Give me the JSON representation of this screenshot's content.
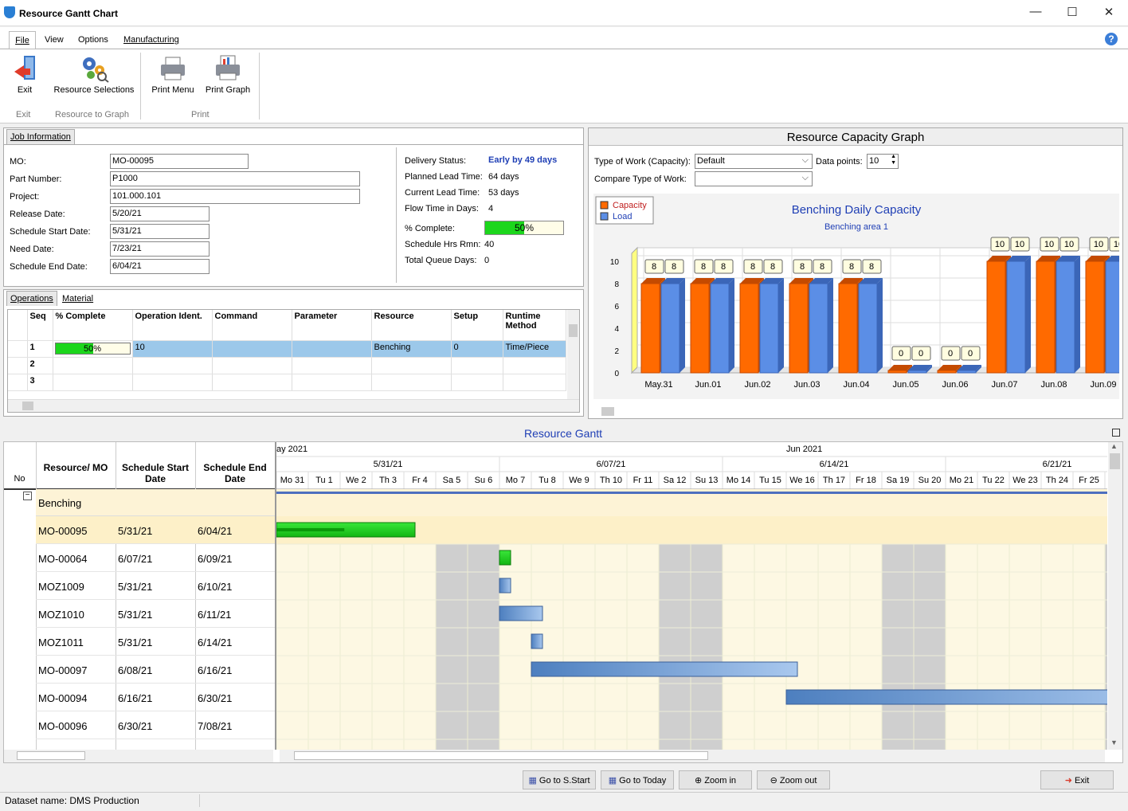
{
  "window": {
    "title": "Resource Gantt Chart",
    "minimize": "—",
    "maximize": "☐",
    "close": "✕"
  },
  "menu": {
    "file": "File",
    "view": "View",
    "options": "Options",
    "manufacturing": "Manufacturing",
    "help": "?"
  },
  "ribbon": {
    "exit": "Exit",
    "resource_selections": "Resource Selections",
    "print_menu": "Print Menu",
    "print_graph": "Print Graph",
    "group_exit": "Exit",
    "group_resource": "Resource to Graph",
    "group_print": "Print"
  },
  "job": {
    "tab": "Job Information",
    "mo_label": "MO:",
    "mo": "MO-00095",
    "part_label": "Part Number:",
    "part": "P1000",
    "project_label": "Project:",
    "project": "101.000.101",
    "release_label": "Release Date:",
    "release": "5/20/21",
    "start_label": "Schedule Start Date:",
    "start": "5/31/21",
    "need_label": "Need Date:",
    "need": "7/23/21",
    "end_label": "Schedule End Date:",
    "end": "6/04/21",
    "delivery_label": "Delivery Status:",
    "delivery": "Early by 49 days",
    "planned_label": "Planned Lead Time:",
    "planned": "64 days",
    "current_label": "Current Lead Time:",
    "current": "53 days",
    "flow_label": "Flow Time in Days:",
    "flow": "4",
    "pct_label": "% Complete:",
    "pct": "50%",
    "pct_value": 0.5,
    "hrs_label": "Schedule Hrs Rmn:",
    "hrs": "40",
    "queue_label": "Total Queue Days:",
    "queue": "0"
  },
  "ops": {
    "tab_ops": "Operations",
    "tab_mat": "Material",
    "headers": [
      "Seq",
      "% Complete",
      "Operation Ident.",
      "Command",
      "Parameter",
      "Resource",
      "Setup",
      "Runtime Method"
    ],
    "rows": [
      {
        "seq": "1",
        "pct": "50%",
        "pct_value": 0.5,
        "ident": "10",
        "command": "",
        "parameter": "",
        "resource": "Benching",
        "setup": "0",
        "runtime": "Time/Piece"
      },
      {
        "seq": "2"
      },
      {
        "seq": "3"
      }
    ]
  },
  "capacity": {
    "title": "Resource Capacity Graph",
    "type_label": "Type of Work (Capacity):",
    "type_value": "Default",
    "dp_label": "Data points:",
    "dp_value": "10",
    "compare_label": "Compare Type of Work:",
    "compare_value": ""
  },
  "chart_data": {
    "type": "bar",
    "title": "Benching Daily Capacity",
    "subtitle": "Benching area 1",
    "categories": [
      "May.31",
      "Jun.01",
      "Jun.02",
      "Jun.03",
      "Jun.04",
      "Jun.05",
      "Jun.06",
      "Jun.07",
      "Jun.08",
      "Jun.09"
    ],
    "series": [
      {
        "name": "Capacity",
        "color": "#ff6a00",
        "values": [
          8,
          8,
          8,
          8,
          8,
          0,
          0,
          10,
          10,
          10
        ]
      },
      {
        "name": "Load",
        "color": "#5b8ee6",
        "values": [
          8,
          8,
          8,
          8,
          8,
          0,
          0,
          10,
          10,
          10
        ]
      }
    ],
    "yticks": [
      "0",
      "2",
      "4",
      "6",
      "8",
      "10"
    ],
    "ylim": [
      0,
      10
    ],
    "legend": "top-left",
    "grid": true
  },
  "gantt": {
    "title": "Resource Gantt",
    "hdr": {
      "no": "No",
      "resource": "Resource/ MO",
      "start": "Schedule Start Date",
      "end": "Schedule End Date"
    },
    "months": [
      {
        "label": "ay 2021"
      },
      {
        "label": "Jun 2021"
      }
    ],
    "weeks": [
      "5/31/21",
      "6/07/21",
      "6/14/21",
      "6/21/21"
    ],
    "days": [
      "Mo 31",
      "Tu 1",
      "We 2",
      "Th 3",
      "Fr 4",
      "Sa 5",
      "Su 6",
      "Mo 7",
      "Tu 8",
      "We 9",
      "Th 10",
      "Fr 11",
      "Sa 12",
      "Su 13",
      "Mo 14",
      "Tu 15",
      "We 16",
      "Th 17",
      "Fr 18",
      "Sa 19",
      "Su 20",
      "Mo 21",
      "Tu 22",
      "We 23",
      "Th 24",
      "Fr 25",
      "S"
    ],
    "group": "Benching",
    "rows": [
      {
        "mo": "MO-00095",
        "start": "5/31/21",
        "end": "6/04/21",
        "bar_start": 0,
        "bar_days": 4.35,
        "progress": 0.5,
        "kind": "green",
        "selected": true
      },
      {
        "mo": "MO-00064",
        "start": "6/07/21",
        "end": "6/09/21",
        "bar_start": 7,
        "bar_days": 0.35,
        "kind": "green"
      },
      {
        "mo": "MOZ1009",
        "start": "5/31/21",
        "end": "6/10/21",
        "bar_start": 7,
        "bar_days": 0.35,
        "kind": "blue"
      },
      {
        "mo": "MOZ1010",
        "start": "5/31/21",
        "end": "6/11/21",
        "bar_start": 7,
        "bar_days": 1.35,
        "kind": "blue"
      },
      {
        "mo": "MOZ1011",
        "start": "5/31/21",
        "end": "6/14/21",
        "bar_start": 8,
        "bar_days": 0.35,
        "kind": "blue"
      },
      {
        "mo": "MO-00097",
        "start": "6/08/21",
        "end": "6/16/21",
        "bar_start": 8,
        "bar_days": 8.35,
        "kind": "blue"
      },
      {
        "mo": "MO-00094",
        "start": "6/16/21",
        "end": "6/30/21",
        "bar_start": 16,
        "bar_days": 12,
        "kind": "blue"
      },
      {
        "mo": "MO-00096",
        "start": "6/30/21",
        "end": "7/08/21"
      }
    ]
  },
  "buttons": {
    "go_start": "Go to S.Start",
    "go_today": "Go to Today",
    "zoom_in": "Zoom in",
    "zoom_out": "Zoom out",
    "exit": "Exit"
  },
  "status": {
    "dataset": "Dataset name:  DMS Production"
  }
}
